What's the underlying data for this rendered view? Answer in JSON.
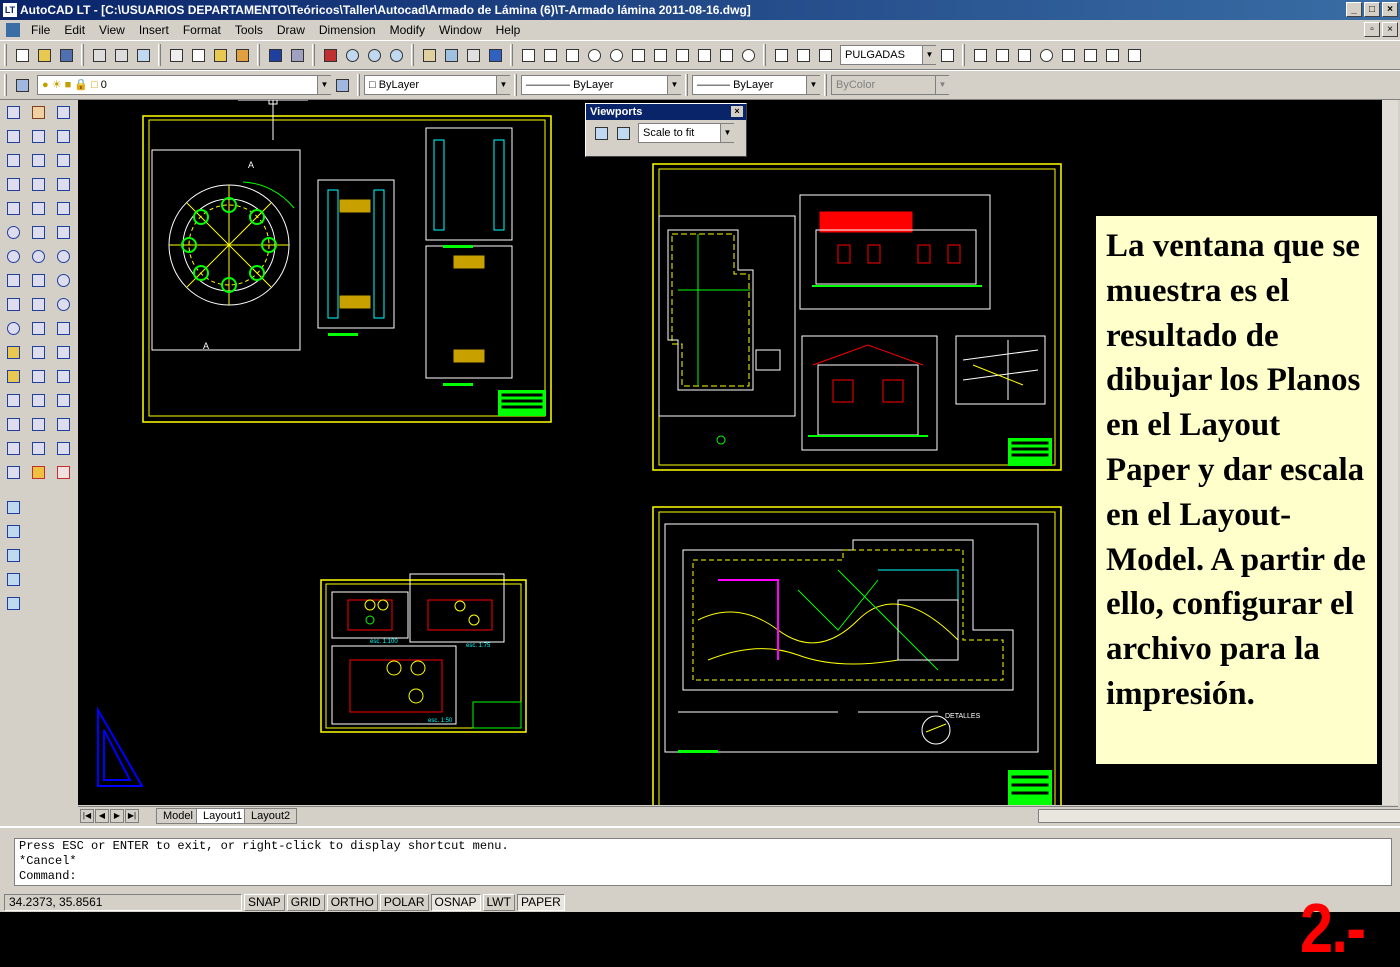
{
  "window": {
    "title": "AutoCAD LT - [C:\\USUARIOS DEPARTAMENTO\\Teóricos\\Taller\\Autocad\\Armado de Lámina (6)\\T-Armado lámina 2011-08-16.dwg]",
    "logo": "LT"
  },
  "menu": [
    "File",
    "Edit",
    "View",
    "Insert",
    "Format",
    "Tools",
    "Draw",
    "Dimension",
    "Modify",
    "Window",
    "Help"
  ],
  "toolbar": {
    "units": "PULGADAS",
    "layer": "0",
    "color": "ByLayer",
    "linetype": "ByLayer",
    "lineweight": "ByLayer",
    "plotstyle": "ByColor"
  },
  "viewports_panel": {
    "title": "Viewports",
    "scale": "Scale to fit"
  },
  "tabs": [
    "Model",
    "Layout1",
    "Layout2"
  ],
  "active_tab": "Layout1",
  "command": {
    "lines": [
      "Press ESC or ENTER to exit, or right-click to display shortcut menu.",
      "*Cancel*"
    ],
    "prompt": "Command:"
  },
  "status": {
    "coords": "34.2373, 35.8561",
    "buttons": [
      "SNAP",
      "GRID",
      "ORTHO",
      "POLAR",
      "OSNAP",
      "LWT",
      "PAPER"
    ],
    "active": [
      "OSNAP",
      "PAPER"
    ]
  },
  "note": "La ventana que se muestra es el resultado de dibujar los Planos en el Layout Paper y dar escala en el Layout-Model. A partir de ello, configurar el archivo para la impresión.",
  "slide_number": "2.-",
  "drawing_labels": [
    "A",
    "A",
    "esc. 1:100",
    "esc. 1:75",
    "esc. 1:50",
    "DETALLES"
  ],
  "colors": {
    "accent": "#ffff00",
    "drawing_green": "#00ff00",
    "slide_number": "#ff0000",
    "note_bg": "#ffffcc"
  }
}
